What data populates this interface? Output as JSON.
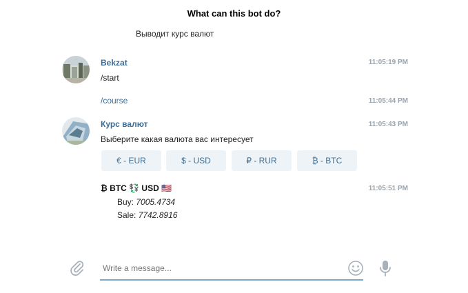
{
  "intro": {
    "title": "What can this bot do?",
    "description": "Выводит курс валют"
  },
  "messages": [
    {
      "sender": "Bekzat",
      "text": "/start",
      "time": "11:05:19 PM"
    },
    {
      "text": "/course",
      "time": "11:05:44 PM"
    },
    {
      "sender": "Курс валют",
      "text": "Выберите какая валюта вас интересует",
      "time": "11:05:43 PM"
    },
    {
      "time": "11:05:51 PM"
    }
  ],
  "keyboard": [
    {
      "label": "€ - EUR"
    },
    {
      "label": "$ - USD"
    },
    {
      "label": "₽ - RUR"
    },
    {
      "label": "₿ - BTC"
    }
  ],
  "rate_message": {
    "header_symbol": "₿",
    "header_text": "BTC 💱 USD 🇺🇸",
    "buy_label": "Buy:",
    "buy_value": "7005.4734",
    "sale_label": "Sale:",
    "sale_value": "7742.8916"
  },
  "composer": {
    "placeholder": "Write a message...",
    "attach_icon": "paperclip-icon",
    "emoji_icon": "smiley-icon",
    "mic_icon": "microphone-icon"
  },
  "colors": {
    "sender": "#3a6d99",
    "timestamp": "#9aa3ab",
    "button_bg": "#eef3f7",
    "button_text": "#3f6e92",
    "input_underline": "#7fa7c5"
  }
}
